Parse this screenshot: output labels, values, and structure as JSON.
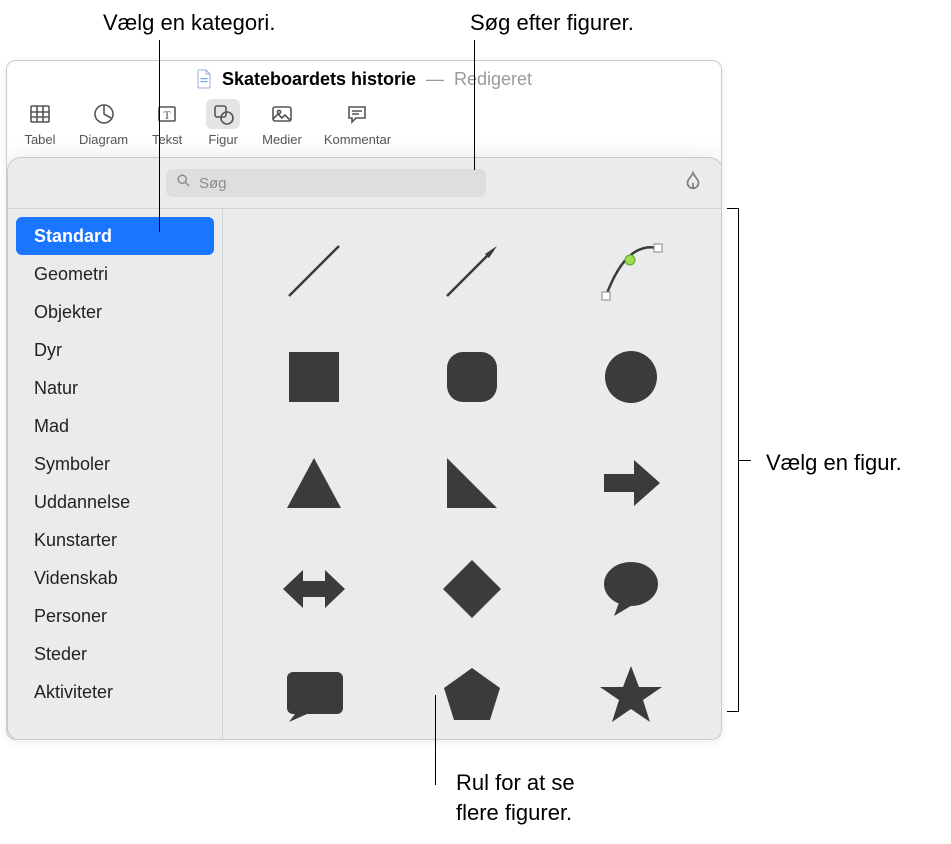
{
  "callouts": {
    "category": "Vælg en kategori.",
    "search": "Søg efter figurer.",
    "pick": "Vælg en figur.",
    "scroll": "Rul for at se\nflere figurer."
  },
  "titlebar": {
    "title": "Skateboardets historie",
    "status": "Redigeret"
  },
  "toolbar": {
    "items": [
      {
        "label": "Tabel",
        "icon": "table-icon"
      },
      {
        "label": "Diagram",
        "icon": "chart-icon"
      },
      {
        "label": "Tekst",
        "icon": "text-icon"
      },
      {
        "label": "Figur",
        "icon": "shape-icon"
      },
      {
        "label": "Medier",
        "icon": "media-icon"
      },
      {
        "label": "Kommentar",
        "icon": "comment-icon"
      }
    ]
  },
  "search": {
    "placeholder": "Søg"
  },
  "sidebar": {
    "items": [
      {
        "label": "Standard",
        "selected": true
      },
      {
        "label": "Geometri"
      },
      {
        "label": "Objekter"
      },
      {
        "label": "Dyr"
      },
      {
        "label": "Natur"
      },
      {
        "label": "Mad"
      },
      {
        "label": "Symboler"
      },
      {
        "label": "Uddannelse"
      },
      {
        "label": "Kunstarter"
      },
      {
        "label": "Videnskab"
      },
      {
        "label": "Personer"
      },
      {
        "label": "Steder"
      },
      {
        "label": "Aktiviteter"
      }
    ]
  },
  "shapes": [
    "line",
    "arrow-line",
    "curve",
    "square",
    "rounded-square",
    "circle",
    "triangle",
    "right-triangle",
    "arrow-right",
    "arrow-both",
    "diamond",
    "speech-bubble",
    "callout-square",
    "pentagon",
    "star"
  ]
}
